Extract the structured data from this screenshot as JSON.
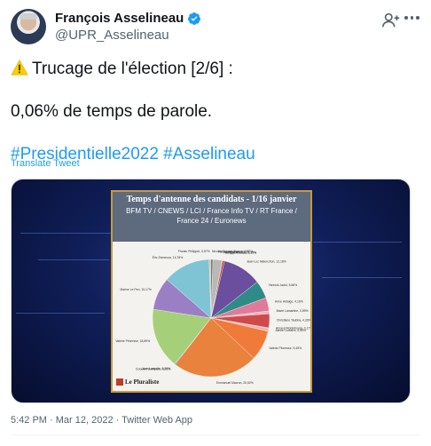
{
  "author": {
    "display_name": "François Asselineau",
    "handle": "@UPR_Asselineau"
  },
  "tweet": {
    "line1": "Trucage de l'élection [2/6] :",
    "line2": "0,06% de temps de parole.",
    "hashtags": "#Presidentielle2022 #Asselineau",
    "translate_label": "Translate Tweet",
    "meta": "5:42 PM · Mar 12, 2022 · Twitter Web App"
  },
  "media": {
    "card_title": "Temps d'antenne des candidats - 1/16 janvier",
    "card_subtitle": "BFM TV / CNEWS / LCI / France Info TV / RT France / France 24 / Euronews",
    "logo_text": "Le Pluraliste"
  },
  "icons": {
    "warning": "warning-icon",
    "verified": "verified-badge-icon",
    "follow": "follow-icon",
    "more": "more-icon"
  },
  "colors": {
    "link": "#1d9bf0",
    "text": "#0f1419",
    "muted": "#536471"
  },
  "chart_data": {
    "type": "pie",
    "title": "Temps d'antenne des candidats - 1/16 janvier",
    "subtitle": "BFM TV / CNEWS / LCI / France Info TV / RT France / France 24 / Euronews",
    "slices": [
      {
        "label": "Fabien Roussel, 2,91%",
        "value": 2.91,
        "color": "#b8b8b8"
      },
      {
        "label": "Nathalie Arthaud, 0,17%",
        "value": 0.17,
        "color": "#8b1a1a"
      },
      {
        "label": "Philippe Poutou, 0,55%",
        "value": 0.55,
        "color": "#c0392b"
      },
      {
        "label": "Jean-Luc Mélenchon, 12,18%",
        "value": 12.18,
        "color": "#6b4e9e"
      },
      {
        "label": "Yannick Jadot, 5,56%",
        "value": 5.56,
        "color": "#2e8b87"
      },
      {
        "label": "Anne Hidalgo, 4,16%",
        "value": 4.16,
        "color": "#e07a9a"
      },
      {
        "label": "Marie Lamartine, 0,89%",
        "value": 0.89,
        "color": "#e8b4c4"
      },
      {
        "label": "Christiane Taubira, 4,33%",
        "value": 4.33,
        "color": "#d04a4a"
      },
      {
        "label": "Arnaud Montebourg, 0,17%",
        "value": 0.17,
        "color": "#c47070"
      },
      {
        "label": "Alexis Corbière, 0,93%",
        "value": 0.93,
        "color": "#f0b0b0"
      },
      {
        "label": "Valérie Pécresse, 9,45%",
        "value": 9.45,
        "color": "#f07a3a"
      },
      {
        "label": "Emmanuel Macron, 26,52%",
        "value": 26.52,
        "color": "#e8823c"
      },
      {
        "label": "Édouard Bompard, 0,21%",
        "value": 0.21,
        "color": "#3a5a8a"
      },
      {
        "label": "Jean Lassalle, 0,06%",
        "value": 0.06,
        "color": "#4aa0d0"
      },
      {
        "label": "Valérie Pécresse, 18,89%",
        "value": 18.89,
        "color": "#a6cf7a"
      },
      {
        "label": "Marine Le Pen, 10,17%",
        "value": 10.17,
        "color": "#9b7fc4"
      },
      {
        "label": "Éric Zemmour, 14,78%",
        "value": 14.78,
        "color": "#7fc4d4"
      },
      {
        "label": "Florian Philippot, 0,57%",
        "value": 0.57,
        "color": "#d4c4a4"
      },
      {
        "label": "Nicolas Dupont-Aignan, 0,57%",
        "value": 0.57,
        "color": "#6a6a6a"
      }
    ]
  }
}
